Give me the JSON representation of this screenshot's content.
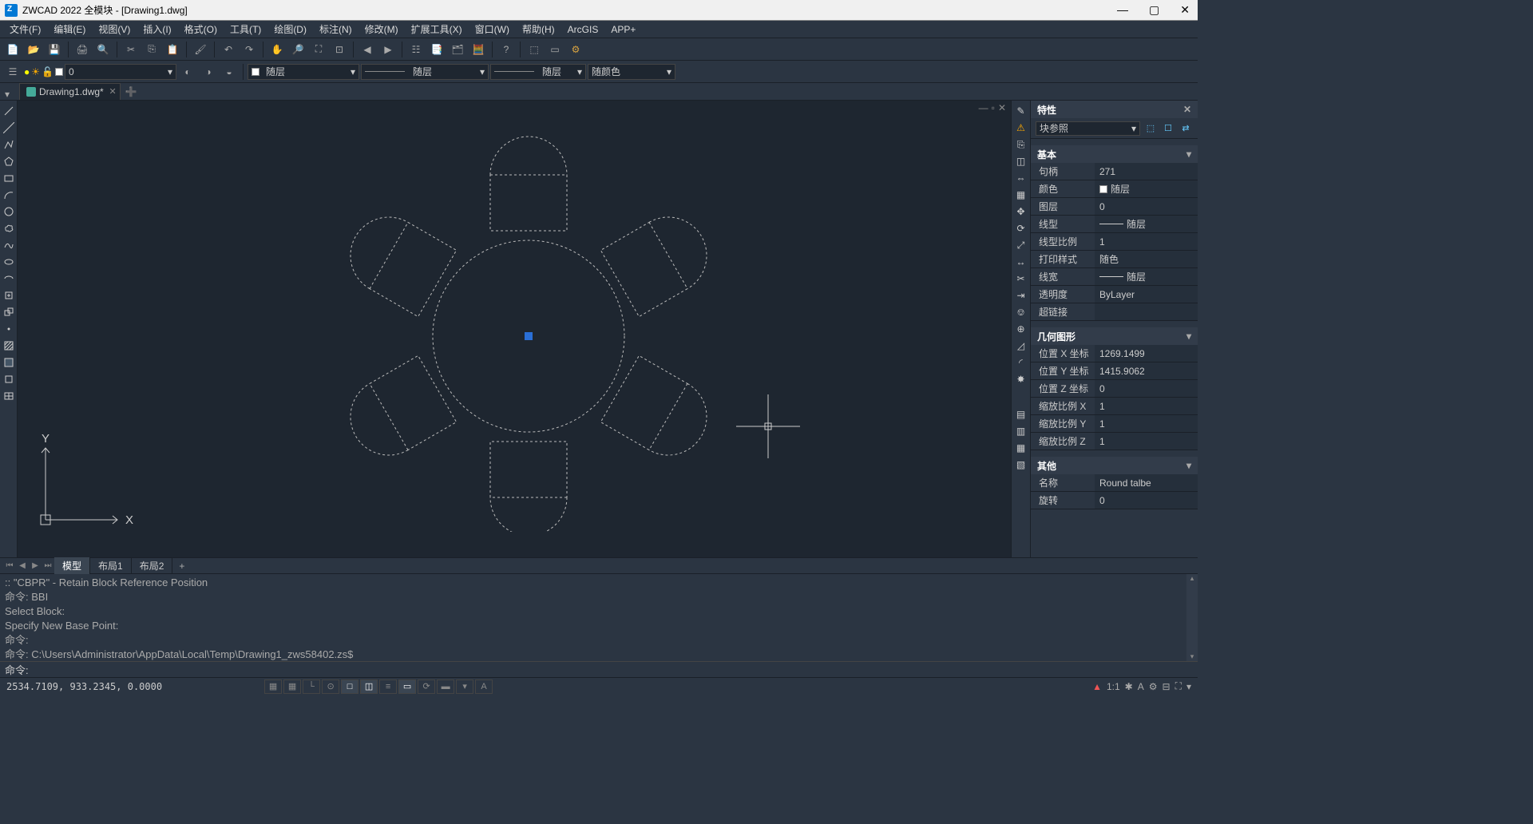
{
  "title": "ZWCAD 2022 全模块 - [Drawing1.dwg]",
  "menu": [
    "文件(F)",
    "编辑(E)",
    "视图(V)",
    "插入(I)",
    "格式(O)",
    "工具(T)",
    "绘图(D)",
    "标注(N)",
    "修改(M)",
    "扩展工具(X)",
    "窗口(W)",
    "帮助(H)",
    "ArcGIS",
    "APP+"
  ],
  "doc_tab": "Drawing1.dwg*",
  "layer_dropdown": "0",
  "linetype_dd1": "随层",
  "linetype_dd2": "随层",
  "linetype_dd3": "随层",
  "color_dd": "随颜色",
  "layout_tabs": {
    "active": "模型",
    "tabs": [
      "模型",
      "布局1",
      "布局2"
    ]
  },
  "cmd_history": [
    "::   \"CBPR\" -  Retain Block Reference Position",
    "命令: BBI",
    "Select Block:",
    "Specify New Base Point:",
    "命令:",
    "命令: C:\\Users\\Administrator\\AppData\\Local\\Temp\\Drawing1_zws58402.zs$"
  ],
  "cmd_prompt": "命令:",
  "status": {
    "coords": "2534.7109, 933.2345, 0.0000",
    "scale": "1:1"
  },
  "props": {
    "title": "特性",
    "selector": "块参照",
    "sections": {
      "basic": {
        "header": "基本",
        "rows": [
          {
            "k": "句柄",
            "v": "271"
          },
          {
            "k": "颜色",
            "v": "随层",
            "swatch": true
          },
          {
            "k": "图层",
            "v": "0"
          },
          {
            "k": "线型",
            "v": "随层",
            "line": true
          },
          {
            "k": "线型比例",
            "v": "1"
          },
          {
            "k": "打印样式",
            "v": "随色"
          },
          {
            "k": "线宽",
            "v": "随层",
            "line": true
          },
          {
            "k": "透明度",
            "v": "ByLayer"
          },
          {
            "k": "超链接",
            "v": ""
          }
        ]
      },
      "geom": {
        "header": "几何图形",
        "rows": [
          {
            "k": "位置 X 坐标",
            "v": "1269.1499"
          },
          {
            "k": "位置 Y 坐标",
            "v": "1415.9062"
          },
          {
            "k": "位置 Z 坐标",
            "v": "0"
          },
          {
            "k": "缩放比例 X",
            "v": "1"
          },
          {
            "k": "缩放比例 Y",
            "v": "1"
          },
          {
            "k": "缩放比例 Z",
            "v": "1"
          }
        ]
      },
      "other": {
        "header": "其他",
        "rows": [
          {
            "k": "名称",
            "v": "Round talbe"
          },
          {
            "k": "旋转",
            "v": "0"
          }
        ]
      }
    }
  },
  "ucs": {
    "x": "X",
    "y": "Y"
  }
}
